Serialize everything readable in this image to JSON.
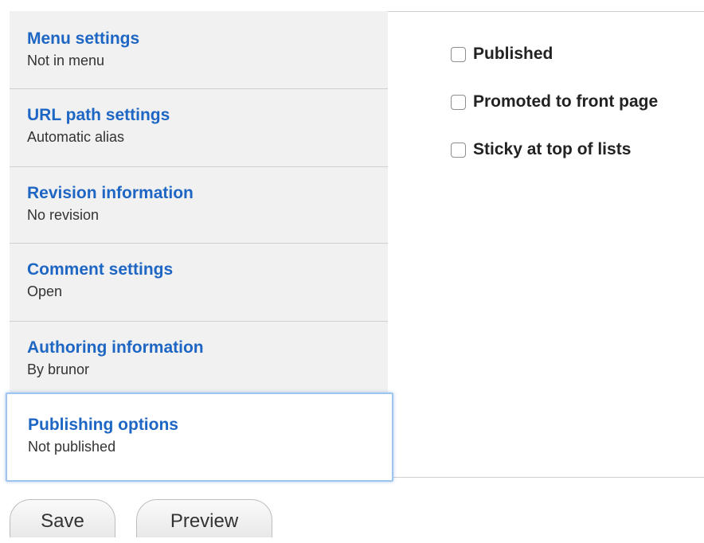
{
  "vertical_tabs": [
    {
      "title": "Menu settings",
      "summary": "Not in menu"
    },
    {
      "title": "URL path settings",
      "summary": "Automatic alias"
    },
    {
      "title": "Revision information",
      "summary": "No revision"
    },
    {
      "title": "Comment settings",
      "summary": "Open"
    },
    {
      "title": "Authoring information",
      "summary": "By brunor"
    },
    {
      "title": "Publishing options",
      "summary": "Not published",
      "active": true
    }
  ],
  "publishing_options": [
    {
      "label": "Published",
      "checked": false
    },
    {
      "label": "Promoted to front page",
      "checked": false
    },
    {
      "label": "Sticky at top of lists",
      "checked": false
    }
  ],
  "actions": {
    "save_label": "Save",
    "preview_label": "Preview"
  },
  "colors": {
    "link": "#1e66c4",
    "active_outline": "#9fc5ef",
    "tab_background": "#f1f1f1"
  }
}
